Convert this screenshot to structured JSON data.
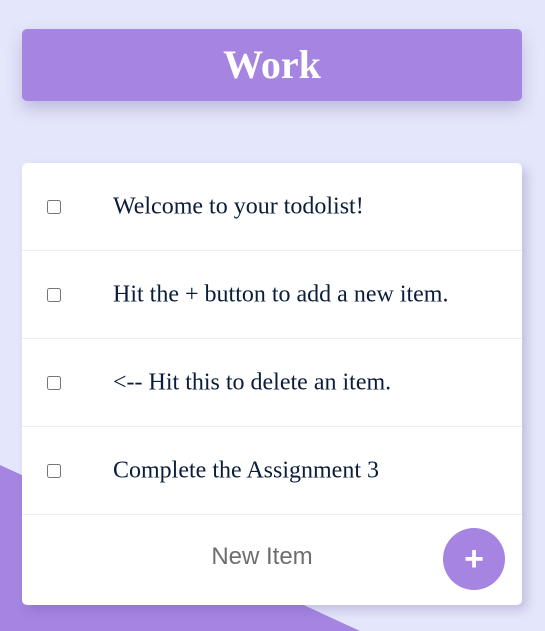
{
  "heading": {
    "title": "Work"
  },
  "items": [
    {
      "text": "Welcome to your todolist!",
      "checked": false
    },
    {
      "text": "Hit the + button to add a new item.",
      "checked": false
    },
    {
      "text": "<-- Hit this to delete an item.",
      "checked": false
    },
    {
      "text": "Complete the Assignment 3",
      "checked": false
    }
  ],
  "form": {
    "placeholder": "New Item",
    "value": "",
    "button_label": "+"
  },
  "colors": {
    "background": "#E4E6FB",
    "accent": "#A684E1",
    "card": "#FFFFFF",
    "item_text": "#0B1D3A"
  },
  "icons": {
    "add": "plus-icon"
  }
}
